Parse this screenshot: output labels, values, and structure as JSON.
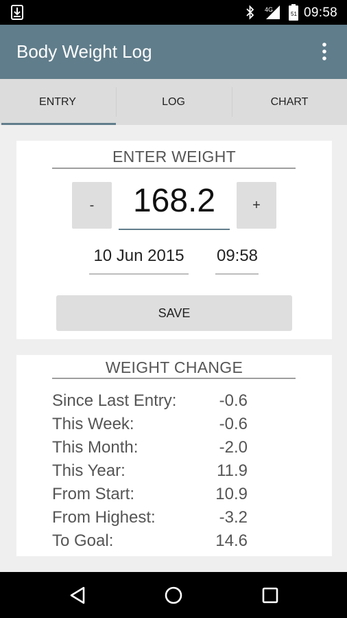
{
  "status_bar": {
    "time": "09:58"
  },
  "app_bar": {
    "title": "Body Weight Log"
  },
  "tabs": [
    {
      "label": "ENTRY"
    },
    {
      "label": "LOG"
    },
    {
      "label": "CHART"
    }
  ],
  "entry": {
    "section_title": "ENTER WEIGHT",
    "minus_label": "-",
    "plus_label": "+",
    "weight": "168.2",
    "date": "10 Jun 2015",
    "time": "09:58",
    "save_label": "SAVE"
  },
  "weight_change": {
    "section_title": "WEIGHT CHANGE",
    "rows": [
      {
        "label": "Since Last Entry:",
        "value": "-0.6"
      },
      {
        "label": "This Week:",
        "value": "-0.6"
      },
      {
        "label": "This Month:",
        "value": "-2.0"
      },
      {
        "label": "This Year:",
        "value": "11.9"
      },
      {
        "label": "From Start:",
        "value": "10.9"
      },
      {
        "label": "From Highest:",
        "value": "-3.2"
      },
      {
        "label": "To Goal:",
        "value": "14.6"
      }
    ]
  },
  "colors": {
    "app_bar": "#607d8b",
    "tab_bar": "#dcdcdc",
    "background": "#efefef"
  }
}
